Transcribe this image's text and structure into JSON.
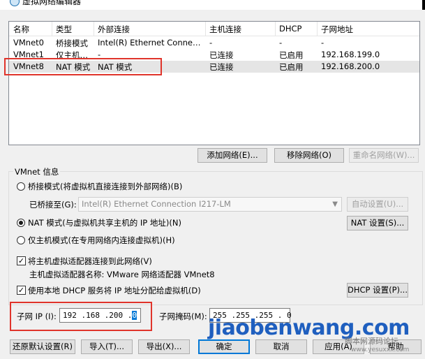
{
  "window": {
    "title": "虚拟网络编辑器"
  },
  "table": {
    "headers": [
      "名称",
      "类型",
      "外部连接",
      "主机连接",
      "DHCP",
      "子网地址"
    ],
    "rows": [
      [
        "VMnet0",
        "桥接模式",
        "Intel(R) Ethernet Connectio…",
        "-",
        "-",
        "-"
      ],
      [
        "VMnet1",
        "仅主机…",
        "-",
        "已连接",
        "已启用",
        "192.168.199.0"
      ],
      [
        "VMnet8",
        "NAT 模式",
        "NAT 模式",
        "已连接",
        "已启用",
        "192.168.200.0"
      ]
    ]
  },
  "list_buttons": {
    "add": "添加网络(E)...",
    "remove": "移除网络(O)",
    "rename": "重命名网络(W)..."
  },
  "vmnet_info": {
    "label": "VMnet 信息",
    "bridged_label": "桥接模式(将虚拟机直接连接到外部网络)(B)",
    "bridged_to_label": "已桥接至(G):",
    "bridged_to_value": "Intel(R) Ethernet Connection I217-LM",
    "auto_settings": "自动设置(U)...",
    "nat_label": "NAT 模式(与虚拟机共享主机的 IP 地址)(N)",
    "nat_settings": "NAT 设置(S)...",
    "hostonly_label": "仅主机模式(在专用网络内连接虚拟机)(H)",
    "connect_adapter_label": "将主机虚拟适配器连接到此网络(V)",
    "adapter_name_label": "主机虚拟适配器名称: VMware 网络适配器 VMnet8",
    "dhcp_label": "使用本地 DHCP 服务将 IP 地址分配给虚拟机(D)",
    "dhcp_settings": "DHCP 设置(P)...",
    "subnet_ip_label": "子网 IP (I):",
    "subnet_ip_value": "192 .168 .200 .",
    "subnet_ip_last": "0",
    "subnet_mask_label": "子网掩码(M):",
    "subnet_mask_value": "255 .255 .255 . 0"
  },
  "footer_buttons": {
    "restore": "还原默认设置(R)",
    "import": "导入(T)...",
    "export": "导出(X)...",
    "ok": "确定",
    "cancel": "取消",
    "apply": "应用(A)",
    "help": "帮助"
  },
  "watermark": {
    "main": "jiaobenwang.com",
    "sub1": "脚本网源码论坛",
    "sub2": "www.yesuxxx.com"
  },
  "colors": {
    "highlight": "#e0342b",
    "focus": "#0078d7",
    "watermark": "#1f5fbf"
  }
}
